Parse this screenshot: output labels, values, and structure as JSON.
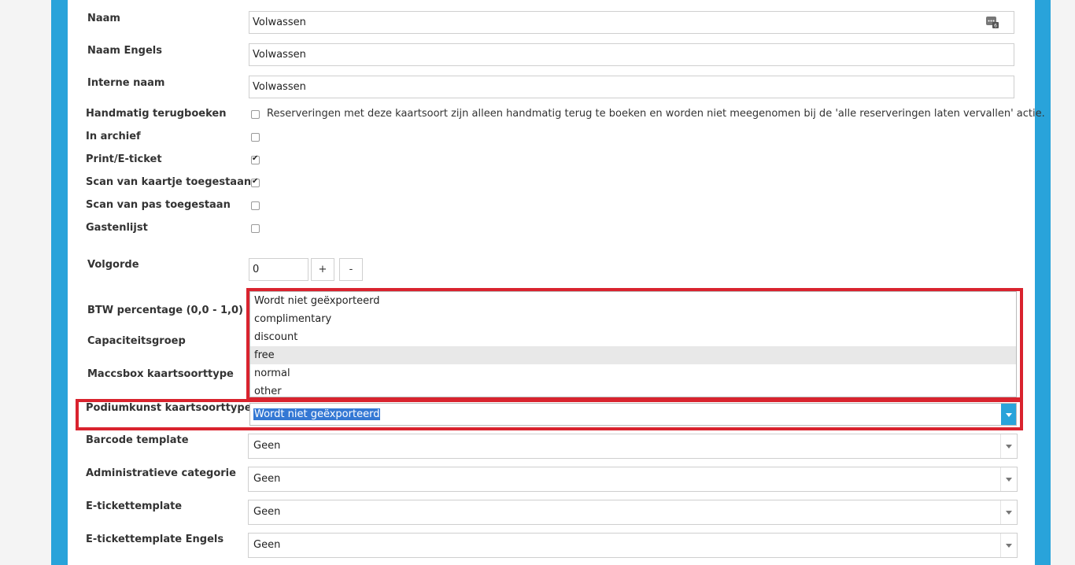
{
  "form": {
    "naam": {
      "label": "Naam",
      "value": "Volwassen"
    },
    "naam_engels": {
      "label": "Naam Engels",
      "value": "Volwassen"
    },
    "interne_naam": {
      "label": "Interne naam",
      "value": "Volwassen"
    },
    "handmatig": {
      "label": "Handmatig terugboeken",
      "checked": false,
      "description": "Reserveringen met deze kaartsoort zijn alleen handmatig terug te boeken en worden niet meegenomen bij de 'alle reserveringen laten vervallen' actie."
    },
    "in_archief": {
      "label": "In archief",
      "checked": false
    },
    "print_eticket": {
      "label": "Print/E-ticket",
      "checked": true
    },
    "scan_kaartje": {
      "label": "Scan van kaartje toegestaan",
      "checked": true
    },
    "scan_pas": {
      "label": "Scan van pas toegestaan",
      "checked": false
    },
    "gastenlijst": {
      "label": "Gastenlijst",
      "checked": false
    },
    "volgorde": {
      "label": "Volgorde",
      "value": "0",
      "plus": "+",
      "minus": "-"
    },
    "btw": {
      "label": "BTW percentage (0,0 - 1,0)"
    },
    "capaciteitsgroep": {
      "label": "Capaciteitsgroep"
    },
    "maccsbox": {
      "label": "Maccsbox kaartsoorttype"
    },
    "podiumkunst": {
      "label": "Podiumkunst kaartsoorttype",
      "selected": "Wordt niet geëxporteerd",
      "options": [
        "Wordt niet geëxporteerd",
        "complimentary",
        "discount",
        "free",
        "normal",
        "other"
      ],
      "hovered_option": "free"
    },
    "barcode_template": {
      "label": "Barcode template",
      "value": "Geen"
    },
    "administratieve_categorie": {
      "label": "Administratieve categorie",
      "value": "Geen"
    },
    "etickettemplate": {
      "label": "E-tickettemplate",
      "value": "Geen"
    },
    "etickettemplate_engels": {
      "label": "E-tickettemplate Engels",
      "value": "Geen"
    }
  },
  "colors": {
    "accent": "#29a3da",
    "highlight": "#d9232e",
    "selection": "#3478d4"
  },
  "icons": {
    "translate": "translate-icon",
    "checkmark": "checkmark-icon",
    "dropdown": "chevron-down-icon"
  }
}
